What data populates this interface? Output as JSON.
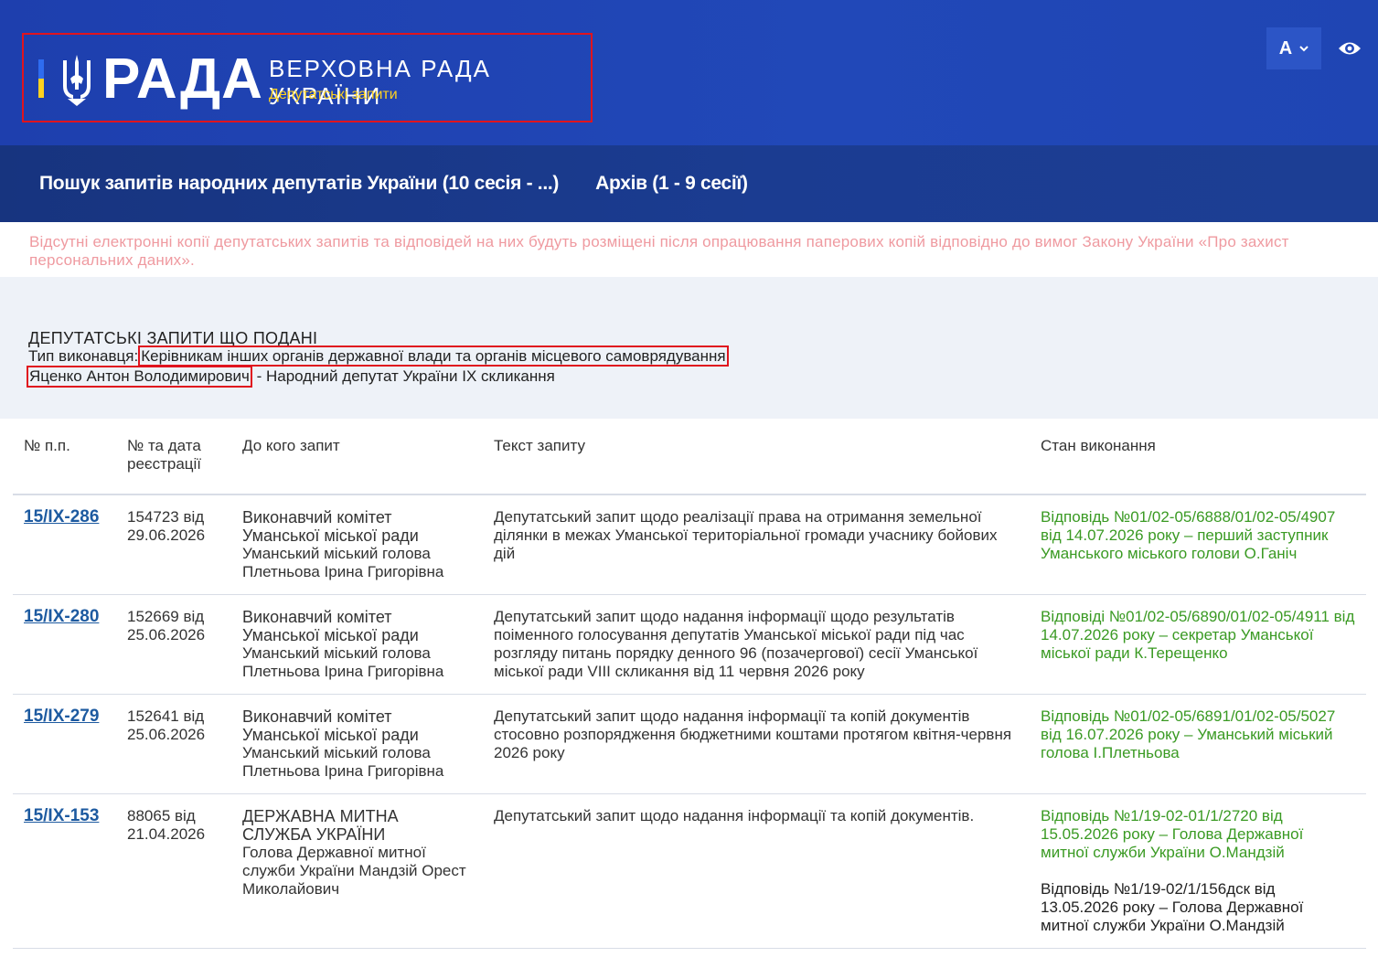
{
  "header": {
    "logo_word": "РАДА",
    "title": "ВЕРХОВНА РАДА УКРАЇНИ",
    "subtitle": "Депутатські запити",
    "font_button": "A",
    "colors": {
      "brand_blue": "#1e3fae",
      "accent_yellow": "#ffd21f",
      "flag_blue": "#2e6cf0"
    }
  },
  "nav": {
    "items": [
      {
        "label": "Пошук запитів народних депутатів України (10 сесія - ...)"
      },
      {
        "label": "Архів (1 - 9 сесії)"
      }
    ]
  },
  "notice": "Відсутні електронні копії депутатських запитів та відповідей на них будуть розміщені після опрацювання паперових копій відповідно до вимог Закону України «Про захист персональних даних».",
  "info": {
    "title": "ДЕПУТАТСЬКІ ЗАПИТИ ЩО ПОДАНІ",
    "executor_label": "Тип виконавця:",
    "executor_value": "Керівникам інших органів державної влади та органів місцевого самоврядування",
    "deputy_name": "Яценко Антон Володимирович",
    "deputy_role": " - Народний депутат України IX скликання"
  },
  "table": {
    "headers": [
      "№ п.п.",
      "№ та дата реєстрації",
      "До кого запит",
      "Текст запиту",
      "Стан виконання"
    ],
    "rows": [
      {
        "num": "15/IX-286",
        "reg": "154723 від 29.06.2026",
        "recipient_main": "Виконавчий комітет Уманської міської ради",
        "recipient_person": "Уманський міський голова Плетньова Ірина Григорівна",
        "text": "Депутатський запит щодо реалізації права на отримання земельної ділянки в межах Уманської територіальної громади учаснику бойових дій",
        "status": "Відповідь №01/02-05/6888/01/02-05/4907 від 14.07.2026 року – перший заступник Уманського міського голови О.Ганіч",
        "status_extra": ""
      },
      {
        "num": "15/IX-280",
        "reg": "152669 від 25.06.2026",
        "recipient_main": "Виконавчий комітет Уманської міської ради",
        "recipient_person": "Уманський міський голова Плетньова Ірина Григорівна",
        "text": "Депутатський запит щодо надання інформації щодо результатів поіменного голосування депутатів Уманської міської ради під час розгляду питань порядку денного 96 (позачергової) сесії Уманської міської ради VIII скликання від 11 червня 2026 року",
        "status": "Відповіді №01/02-05/6890/01/02-05/4911 від 14.07.2026 року – секретар Уманської міської ради К.Терещенко",
        "status_extra": ""
      },
      {
        "num": "15/IX-279",
        "reg": "152641 від 25.06.2026",
        "recipient_main": "Виконавчий комітет Уманської міської ради",
        "recipient_person": "Уманський міський голова Плетньова Ірина Григорівна",
        "text": "Депутатський запит щодо надання інформації та копій документів стосовно розпорядження бюджетними коштами протягом квітня-червня 2026 року",
        "status": "Відповідь №01/02-05/6891/01/02-05/5027 від 16.07.2026 року – Уманський міський голова І.Плетньова",
        "status_extra": ""
      },
      {
        "num": "15/IX-153",
        "reg": "88065 від 21.04.2026",
        "recipient_main": "ДЕРЖАВНА МИТНА СЛУЖБА УКРАЇНИ",
        "recipient_person": "Голова Державної митної служби України Мандзій Орест Миколайович",
        "text": "Депутатський запит щодо надання інформації та копій документів.",
        "status": "Відповідь №1/19-02-01/1/2720 від 15.05.2026 року – Голова Державної митної служби України О.Мандзій",
        "status_extra": "Відповідь №1/19-02/1/156дск від 13.05.2026 року – Голова Державної митної служби України О.Мандзій"
      }
    ]
  }
}
